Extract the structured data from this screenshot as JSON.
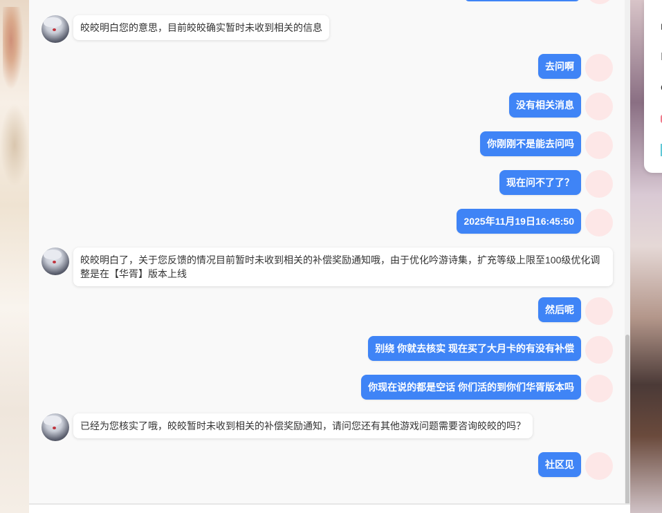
{
  "colors": {
    "user_bubble": "#3f84f6",
    "bot_bubble": "#ffffff",
    "user_avatar": "#fde7e7",
    "chat_background": "#f9f9f9"
  },
  "messages": [
    {
      "role": "bot",
      "text": "皎皎明白您的意思，目前皎皎确实暂时未收到相关的信息"
    },
    {
      "role": "user",
      "text": "去问啊"
    },
    {
      "role": "user",
      "text": "没有相关消息"
    },
    {
      "role": "user",
      "text": "你刚刚不是能去问吗"
    },
    {
      "role": "user",
      "text": "现在问不了了？"
    },
    {
      "role": "user",
      "text": "2025年11月19日16:45:50"
    },
    {
      "role": "bot",
      "text": "皎皎明白了，关于您反馈的情况目前暂时未收到相关的补偿奖励通知哦，由于优化吟游诗集，扩充等级上限至100级优化调整是在【华胥】版本上线"
    },
    {
      "role": "user",
      "text": "然后呢"
    },
    {
      "role": "user",
      "text": "别绕 你就去核实 现在买了大月卡的有没有补偿"
    },
    {
      "role": "user",
      "text": "你现在说的都是空话 你们活的到你们华胥版本吗"
    },
    {
      "role": "bot",
      "text": "已经为您核实了哦，皎皎暂时未收到相关的补偿奖励通知，请问您还有其他游戏问题需要咨询皎皎的吗？"
    },
    {
      "role": "user",
      "text": "社区见"
    }
  ],
  "right_card": {
    "glyphs": [
      "r",
      "I",
      "e"
    ]
  }
}
